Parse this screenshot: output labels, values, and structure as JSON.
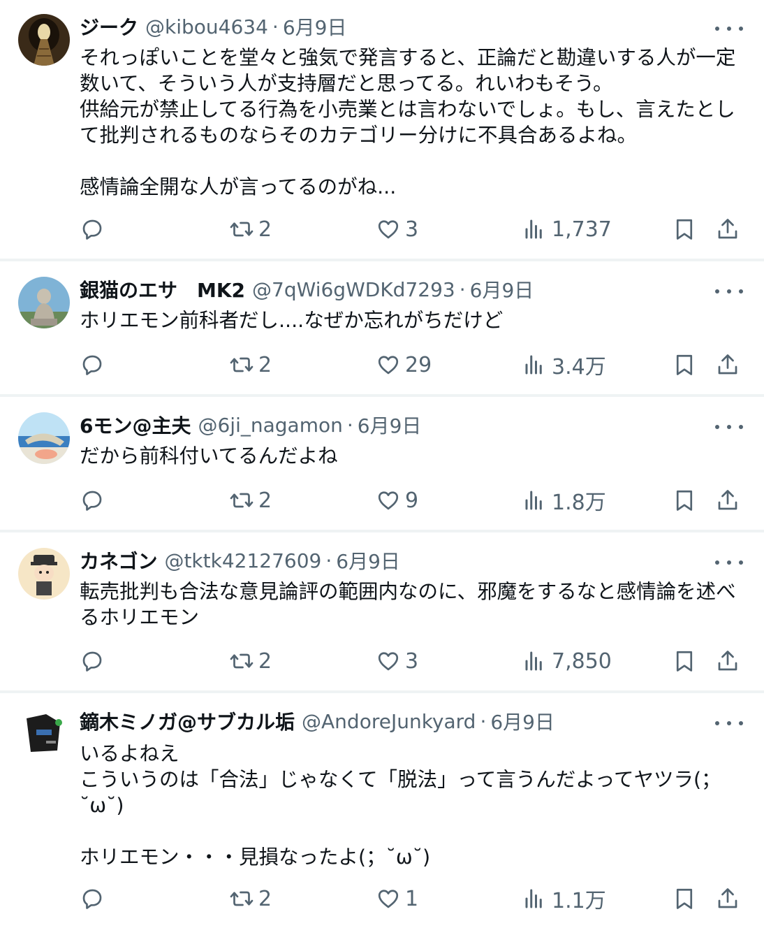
{
  "tweets": [
    {
      "name": "ジーク",
      "handle": "@kibou4634",
      "date": "6月9日",
      "text": "それっぽいことを堂々と強気で発言すると、正論だと勘違いする人が一定数いて、そういう人が支持層だと思ってる。れいわもそう。\n供給元が禁止してる行為を小売業とは言わないでしょ。もし、言えたとして批判されるものならそのカテゴリー分けに不具合あるよね。\n\n感情論全開な人が言ってるのがね...",
      "retweets": "2",
      "likes": "3",
      "views": "1,737"
    },
    {
      "name": "銀猫のエサ　MK2",
      "handle": "@7qWi6gWDKd7293",
      "date": "6月9日",
      "text": "ホリエモン前科者だし....なぜか忘れがちだけど",
      "retweets": "2",
      "likes": "29",
      "views": "3.4万"
    },
    {
      "name": "6モン@主夫",
      "handle": "@6ji_nagamon",
      "date": "6月9日",
      "text": "だから前科付いてるんだよね",
      "retweets": "2",
      "likes": "9",
      "views": "1.8万"
    },
    {
      "name": "カネゴン",
      "handle": "@tktk42127609",
      "date": "6月9日",
      "text": "転売批判も合法な意見論評の範囲内なのに、邪魔をするなと感情論を述べるホリエモン",
      "retweets": "2",
      "likes": "3",
      "views": "7,850"
    },
    {
      "name": "鏑木ミノガ@サブカル垢",
      "handle": "@AndoreJunkyard",
      "date": "6月9日",
      "text": "いるよねえ\nこういうのは「合法」じゃなくて「脱法」って言うんだよってヤツラ(；˘ω˘)\n\nホリエモン・・・見損なったよ(；˘ω˘)",
      "retweets": "2",
      "likes": "1",
      "views": "1.1万"
    }
  ],
  "colors": {
    "text": "#0f1419",
    "secondary": "#536471",
    "divider": "#eff3f4"
  },
  "icons": [
    "more-icon",
    "reply-icon",
    "retweet-icon",
    "like-icon",
    "views-icon",
    "bookmark-icon",
    "share-icon"
  ]
}
